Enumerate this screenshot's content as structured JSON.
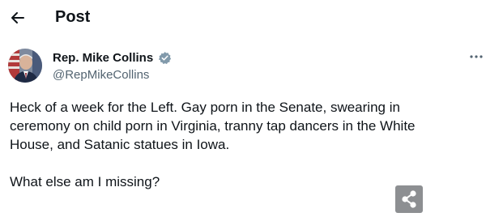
{
  "header": {
    "title": "Post",
    "back_icon": "arrow-left-icon"
  },
  "post": {
    "author": {
      "name": "Rep. Mike Collins",
      "handle": "@RepMikeCollins",
      "verified_icon": "verified-badge-icon",
      "verified_color": "#829aab"
    },
    "more_icon": "ellipsis-icon",
    "text_lines": [
      "Heck of a week for the Left. Gay porn in the Senate, swearing in",
      "ceremony on child porn in Virginia, tranny tap dancers in the White",
      "House, and Satanic statues in Iowa."
    ],
    "text_last": "What else am I missing?",
    "share_icon": "share-icon"
  }
}
